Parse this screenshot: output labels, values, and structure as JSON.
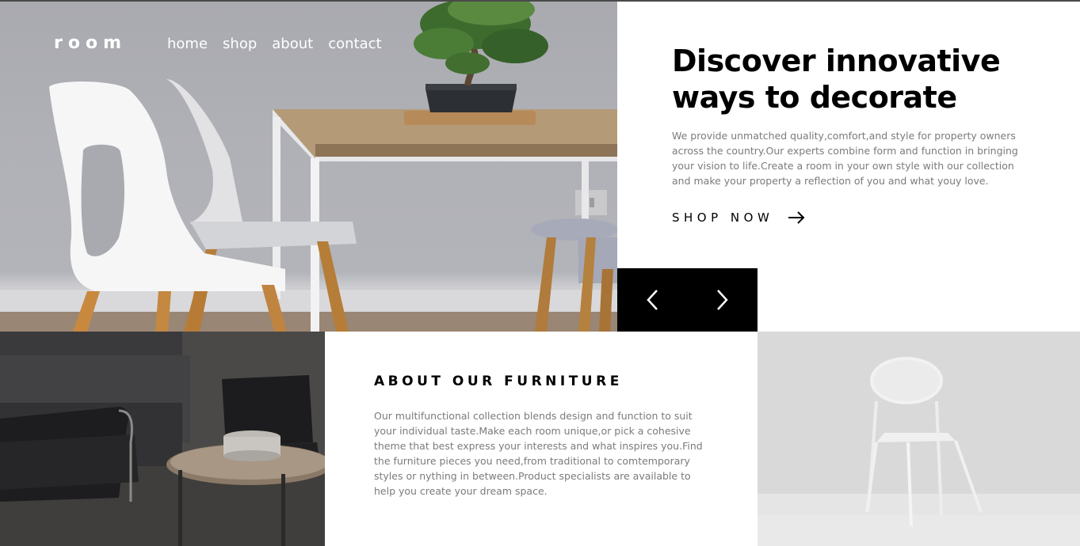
{
  "brand": {
    "logo": "room"
  },
  "nav": {
    "items": [
      "home",
      "shop",
      "about",
      "contact"
    ]
  },
  "hero": {
    "title": "Discover innovative ways to decorate",
    "description": "We provide unmatched quality,comfort,and style for property owners across the country.Our experts combine form and function in bringing your vision to life.Create a room in your own style with our collection and make your property a reflection of you and what youy love.",
    "cta_label": "SHOP NOW"
  },
  "slider": {
    "prev_icon": "chevron-left-icon",
    "next_icon": "chevron-right-icon"
  },
  "about": {
    "title": "ABOUT OUR FURNITURE",
    "description": "Our multifunctional collection blends design and function to suit your individual taste.Make each room unique,or pick a cohesive theme that best express your interests and what inspires you.Find the furniture pieces you need,from traditional to comtemporary styles or nything in between.Product specialists are available to help you create your dream space."
  },
  "colors": {
    "accent": "#000000",
    "body_text": "#7b7b7b",
    "nav_text": "#ffffff"
  }
}
